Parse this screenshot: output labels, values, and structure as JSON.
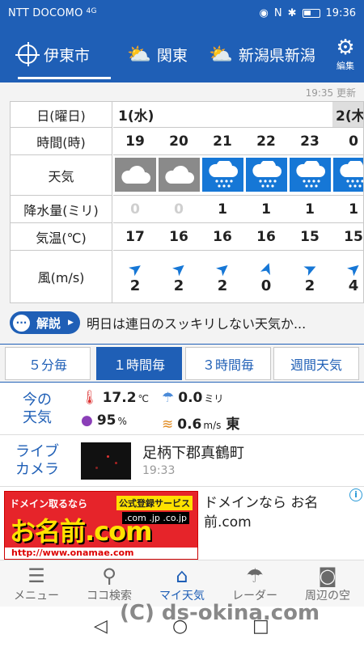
{
  "status_bar": {
    "carrier": "NTT DOCOMO",
    "signal": "4G",
    "time": "19:36"
  },
  "header": {
    "tabs": [
      {
        "label": "伊東市",
        "icon": "location-crosshair-icon",
        "active": true
      },
      {
        "label": "関東",
        "icon": "sun-cloud-icon",
        "active": false
      },
      {
        "label": "新潟県新潟",
        "icon": "sun-cloud-icon",
        "active": false
      }
    ],
    "edit_label": "編集"
  },
  "forecast": {
    "updated": "19:35 更新",
    "row_labels": [
      "日(曜日)",
      "時間(時)",
      "天気",
      "降水量(ミリ)",
      "気温(℃)",
      "風(m/s)"
    ],
    "day1": "1(水)",
    "day2": "2(木",
    "hours": [
      "19",
      "20",
      "21",
      "22",
      "23",
      "0"
    ],
    "weather": [
      "cloudy",
      "cloudy",
      "rain",
      "rain",
      "rain",
      "rain"
    ],
    "precip": [
      "0",
      "0",
      "1",
      "1",
      "1",
      "1"
    ],
    "temp": [
      "17",
      "16",
      "16",
      "16",
      "15",
      "15"
    ],
    "wind_speed": [
      "2",
      "2",
      "2",
      "0",
      "2",
      "4"
    ]
  },
  "comment": {
    "badge": "解説",
    "text": "明日は連日のスッキリしない天気か..."
  },
  "interval_tabs": [
    "５分毎",
    "１時間毎",
    "３時間毎",
    "週間天気"
  ],
  "current": {
    "label_line1": "今の",
    "label_line2": "天気",
    "temp_value": "17.2",
    "temp_unit": "℃",
    "rain_value": "0.0",
    "rain_unit": "ミリ",
    "humidity_value": "95",
    "humidity_unit": "%",
    "wind_value": "0.6",
    "wind_unit": "m/s",
    "wind_dir": "東"
  },
  "live_camera": {
    "label_line1": "ライブ",
    "label_line2": "カメラ",
    "location": "足柄下郡真鶴町",
    "time": "19:33"
  },
  "ad": {
    "banner_top": "ドメイン取るなら",
    "banner_badge": "公式登録サービス",
    "banner_big": "お名前.com",
    "banner_tld": ".com .jp .co.jp",
    "banner_url": "http://www.onamae.com",
    "text": "ドメインなら お名前.com",
    "info": "i"
  },
  "bottom_nav": [
    {
      "label": "メニュー",
      "icon": "menu-icon"
    },
    {
      "label": "ココ検索",
      "icon": "search-icon"
    },
    {
      "label": "マイ天気",
      "icon": "home-icon",
      "active": true
    },
    {
      "label": "レーダー",
      "icon": "umbrella-icon"
    },
    {
      "label": "周辺の空",
      "icon": "camera-icon"
    }
  ],
  "watermark": "(C) ds-okina.com",
  "colors": {
    "primary": "#1f5fb6",
    "rain_cell": "#1677d6",
    "cloud_cell": "#8a8a8a"
  }
}
